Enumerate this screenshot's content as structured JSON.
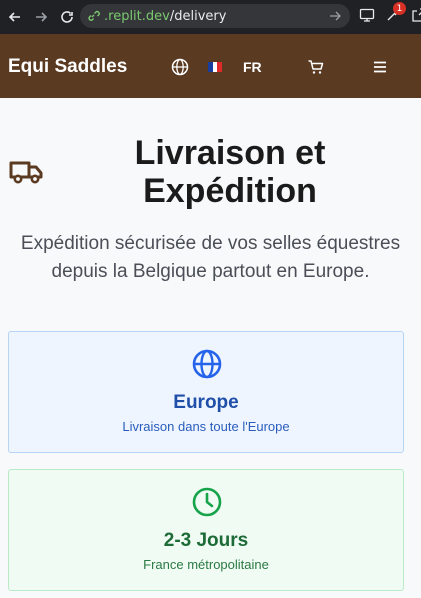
{
  "browser": {
    "url_domain": ".replit.dev",
    "url_path": "/delivery",
    "extension_badge": "1"
  },
  "header": {
    "brand": "Equi Saddles",
    "language": "FR",
    "bg_color": "#5b3a22"
  },
  "hero": {
    "title": "Livraison et Expédition",
    "subtitle": "Expédition sécurisée de vos selles équestres depuis la Belgique partout en Europe."
  },
  "cards": [
    {
      "title": "Europe",
      "description": "Livraison dans toute l'Europe",
      "icon": "globe-icon",
      "color": "#2563eb"
    },
    {
      "title": "2-3 Jours",
      "description": "France métropolitaine",
      "icon": "clock-icon",
      "color": "#16a34a"
    }
  ]
}
